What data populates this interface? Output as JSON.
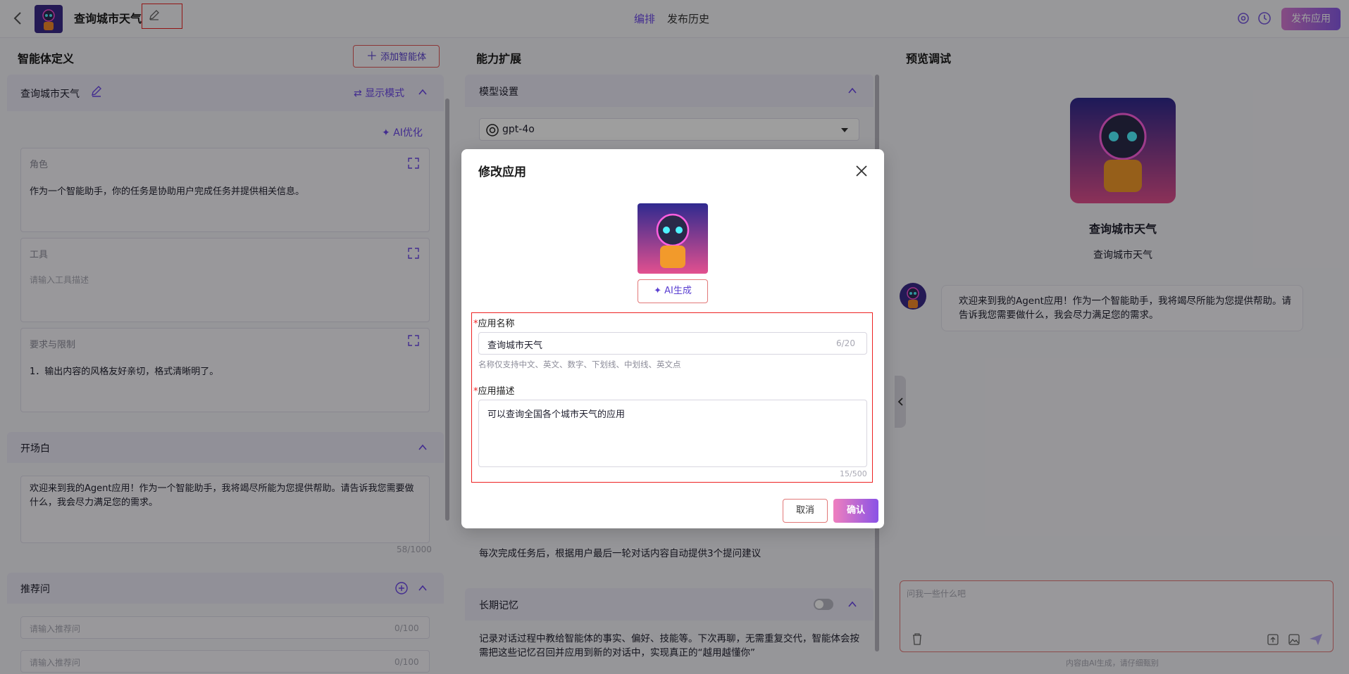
{
  "header": {
    "app_name": "查询城市天气",
    "tabs": [
      "编排",
      "发布历史"
    ],
    "publish_label": "发布应用"
  },
  "left": {
    "title": "智能体定义",
    "add_agent_label": "添加智能体",
    "agent_name": "查询城市天气",
    "display_mode_label": "显示模式",
    "ai_optimize_label": "AI优化",
    "role": {
      "label": "角色",
      "value": "作为一个智能助手，你的任务是协助用户完成任务并提供相关信息。"
    },
    "tools": {
      "label": "工具",
      "placeholder": "请输入工具描述"
    },
    "requirements": {
      "label": "要求与限制",
      "value": "1．输出内容的风格友好亲切，格式清晰明了。"
    },
    "opening": {
      "label": "开场白",
      "value": "欢迎来到我的Agent应用！作为一个智能助手，我将竭尽所能为您提供帮助。请告诉我您需要做什么，我会尽力满足您的需求。",
      "count": "58/1000"
    },
    "suggested": {
      "label": "推荐问",
      "items": [
        {
          "placeholder": "请输入推荐问",
          "count": "0/100"
        },
        {
          "placeholder": "请输入推荐问",
          "count": "0/100"
        }
      ]
    }
  },
  "middle": {
    "title": "能力扩展",
    "model_section_label": "模型设置",
    "model_value": "gpt-4o",
    "suggest_text": "每次完成任务后，根据用户最后一轮对话内容自动提供3个提问建议",
    "memory_label": "长期记忆",
    "memory_text": "记录对话过程中教给智能体的事实、偏好、技能等。下次再聊，无需重复交代，智能体会按需把这些记忆召回并应用到新的对话中，实现真正的“越用越懂你”"
  },
  "right": {
    "title": "预览调试",
    "bot_name": "查询城市天气",
    "bot_desc": "查询城市天气",
    "greeting": "欢迎来到我的Agent应用！作为一个智能助手，我将竭尽所能为您提供帮助。请告诉我您需要做什么，我会尽力满足您的需求。",
    "input_placeholder": "问我一些什么吧",
    "footer_note": "内容由AI生成，请仔细甄别"
  },
  "modal": {
    "title": "修改应用",
    "ai_gen_label": "AI生成",
    "name_label": "应用名称",
    "name_value": "查询城市天气",
    "name_count": "6/20",
    "name_hint": "名称仅支持中文、英文、数字、下划线、中划线、英文点",
    "desc_label": "应用描述",
    "desc_value": "可以查询全国各个城市天气的应用",
    "desc_count": "15/500",
    "cancel_label": "取消",
    "confirm_label": "确认"
  },
  "colors": {
    "accent": "#6b48e8",
    "highlight": "#e22222"
  }
}
